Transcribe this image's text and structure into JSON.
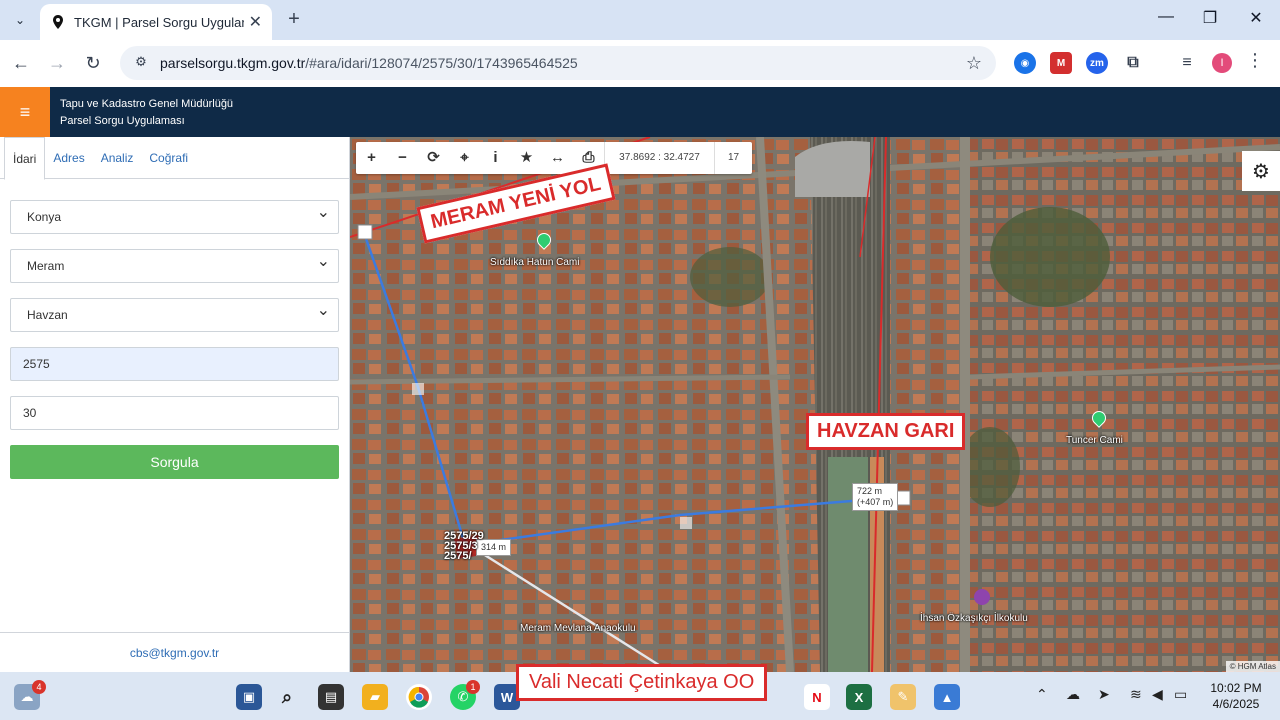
{
  "browser": {
    "tab_title": "TKGM | Parsel Sorgu Uygulaması",
    "url_host": "parselsorgu.tkgm.gov.tr",
    "url_path": "/#ara/idari/128074/2575/30/1743965464525"
  },
  "header": {
    "line1": "Tapu ve Kadastro Genel Müdürlüğü",
    "line2": "Parsel Sorgu Uygulaması"
  },
  "sidebar": {
    "tabs": [
      "İdari",
      "Adres",
      "Analiz",
      "Coğrafi"
    ],
    "province": "Konya",
    "district": "Meram",
    "neighborhood": "Havzan",
    "block": "2575",
    "parcel": "30",
    "submit_label": "Sorgula",
    "footer_email": "cbs@tkgm.gov.tr"
  },
  "map": {
    "coordinates": "37.8692 : 32.4727",
    "zoom": "17",
    "callouts": {
      "road": "MERAM YENİ YOL",
      "station": "HAVZAN GARI",
      "school": "Vali Necati Çetinkaya OO"
    },
    "measurements": {
      "short": "314 m",
      "long_line1": "722 m",
      "long_line2": "(+407 m)"
    },
    "pois": [
      "Sıddıka Hatun Cami",
      "Tuncer Cami",
      "Meram Mevlana Anaokulu",
      "İhsan Özkaşıkçı İlkokulu"
    ],
    "parcel_labels": [
      "2575/29",
      "2575/3",
      "2575/"
    ],
    "attribution": "© HGM Atlas"
  },
  "taskbar": {
    "time": "10:02 PM",
    "date": "4/6/2025",
    "notification_count_weather": "4",
    "notification_count_whatsapp": "1"
  },
  "colors": {
    "header_bg": "#0f2a47",
    "menu_accent": "#f6821f",
    "submit_green": "#5cb85c",
    "callout_red": "#d92b2b",
    "measure_line": "#3b7be0"
  }
}
